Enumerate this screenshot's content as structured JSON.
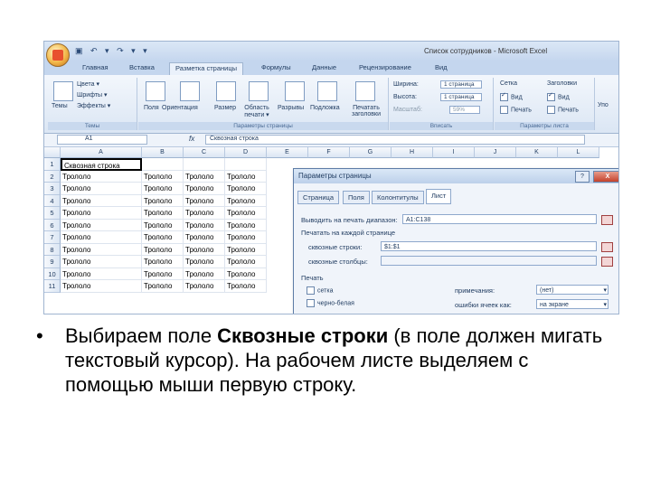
{
  "window": {
    "title": "Список сотрудников - Microsoft Excel",
    "qat": "▣ ↶ ▾ ↷ ▾ ▾"
  },
  "tabs": [
    "Главная",
    "Вставка",
    "Разметка страницы",
    "Формулы",
    "Данные",
    "Рецензирование",
    "Вид"
  ],
  "active_tab_index": 2,
  "ribbon": {
    "themes": {
      "big": "Темы",
      "colors": "Цвета ▾",
      "fonts": "Шрифты ▾",
      "effects": "Эффекты ▾",
      "label": "Темы"
    },
    "page_setup": {
      "buttons": [
        "Поля",
        "Ориентация",
        "Размер",
        "Область печати ▾",
        "Разрывы",
        "Подложка",
        "Печатать заголовки"
      ],
      "label": "Параметры страницы"
    },
    "fit": {
      "width_label": "Ширина:",
      "width_value": "1 страница",
      "height_label": "Высота:",
      "height_value": "1 страница",
      "scale_label": "Масштаб:",
      "scale_value": "59%",
      "label": "Вписать"
    },
    "sheet_options": {
      "grid": "Сетка",
      "headers": "Заголовки",
      "view": "Вид",
      "print": "Печать",
      "label": "Параметры листа"
    },
    "arrange": "Упо"
  },
  "formula_bar": {
    "name_box": "A1",
    "fx": "fx",
    "content": "Сквозная строка"
  },
  "grid": {
    "columns": [
      "A",
      "B",
      "C",
      "D",
      "E",
      "F",
      "G",
      "H",
      "I",
      "J",
      "K",
      "L"
    ],
    "rows": [
      {
        "num": "1",
        "a": "Сквозная строка",
        "rest": [
          "",
          "",
          ""
        ]
      },
      {
        "num": "2",
        "a": "Трололо",
        "rest": [
          "Трололо",
          "Трололо",
          "Трололо"
        ]
      },
      {
        "num": "3",
        "a": "Трололо",
        "rest": [
          "Трололо",
          "Трололо",
          "Трололо"
        ]
      },
      {
        "num": "4",
        "a": "Трололо",
        "rest": [
          "Трололо",
          "Трололо",
          "Трололо"
        ]
      },
      {
        "num": "5",
        "a": "Трололо",
        "rest": [
          "Трололо",
          "Трололо",
          "Трололо"
        ]
      },
      {
        "num": "6",
        "a": "Трололо",
        "rest": [
          "Трололо",
          "Трололо",
          "Трололо"
        ]
      },
      {
        "num": "7",
        "a": "Трололо",
        "rest": [
          "Трололо",
          "Трололо",
          "Трололо"
        ]
      },
      {
        "num": "8",
        "a": "Трололо",
        "rest": [
          "Трололо",
          "Трололо",
          "Трололо"
        ]
      },
      {
        "num": "9",
        "a": "Трололо",
        "rest": [
          "Трололо",
          "Трололо",
          "Трололо"
        ]
      },
      {
        "num": "10",
        "a": "Трололо",
        "rest": [
          "Трололо",
          "Трололо",
          "Трололо"
        ]
      },
      {
        "num": "11",
        "a": "Трололо",
        "rest": [
          "Трололо",
          "Трололо",
          "Трололо"
        ]
      }
    ]
  },
  "dialog": {
    "title": "Параметры страницы",
    "help": "?",
    "close": "X",
    "tabs": [
      "Страница",
      "Поля",
      "Колонтитулы",
      "Лист"
    ],
    "active_tab": 3,
    "print_area_label": "Выводить на печать диапазон:",
    "print_area_value": "A1:C138",
    "print_titles_label": "Печатать на каждой странице",
    "rows_label": "сквозные строки:",
    "rows_value": "$1:$1",
    "cols_label": "сквозные столбцы:",
    "print_label": "Печать",
    "grid_cb": "сетка",
    "bw_cb": "черно-белая",
    "comments_label": "примечания:",
    "comments_value": "(нет)",
    "errors_label": "ошибки ячеек как:",
    "errors_value": "на экране"
  },
  "caption": {
    "bullet": "•",
    "before": "Выбираем поле ",
    "bold": "Сквозные строки",
    "after": " (в поле должен мигать текстовый курсор). На рабочем листе выделяем с помощью мыши первую строку."
  }
}
